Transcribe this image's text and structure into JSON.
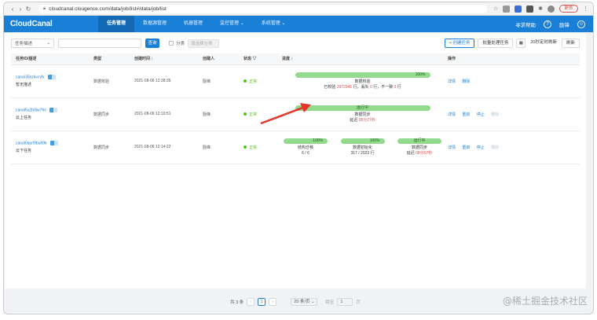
{
  "browser": {
    "url": "cloudcanal.clougence.com/data/job/list#/data/job/list",
    "update_label": "更新"
  },
  "header": {
    "logo": "CloudCanal",
    "nav": [
      "任务管理",
      "数据源管理",
      "机器管理",
      "监控管理 ⌄",
      "系统管理 ⌄"
    ],
    "help": "寻求帮助",
    "user": "励锋"
  },
  "toolbar": {
    "filter_select": "任务描述",
    "query_label": "查询",
    "group_label": "分类",
    "group_placeholder": "请选择分类",
    "create_label": "+ 创建任务",
    "batch_label": "批量处理任务",
    "auto_refresh": "20秒定时刷新",
    "refresh_label": "刷新"
  },
  "table": {
    "headers": [
      "任务ID/描述",
      "类型",
      "创建时间 ↕",
      "创建人",
      "状态 ▽",
      "进度 ↕",
      "操作"
    ],
    "rows": [
      {
        "id": "canal35hzkvcvfx",
        "desc": "暂无描述",
        "type": "数据校验",
        "time": "2021-08-06 12:38:35",
        "user": "励锋",
        "status": "正常",
        "progress": {
          "percent_label": "100%",
          "percent": 1.0,
          "title": "数据校验",
          "checked_prefix": "已校验",
          "checked": "3972941",
          "checked_mid": "行，丢失",
          "lost": "0",
          "lost_mid": "行，不一致",
          "diff": "0",
          "diff_suffix": "行"
        },
        "actions": [
          "详情",
          "删除"
        ]
      },
      {
        "id": "canal5u2b0lw7fnl",
        "desc": "云上任务",
        "type": "数据同步",
        "time": "2021-08-06 12:19:51",
        "user": "励锋",
        "status": "正常",
        "progress": {
          "bar_label": "运行中",
          "title": "数据同步",
          "delay_prefix": "延迟",
          "delay": "08分27秒"
        },
        "actions": [
          "详情",
          "重启",
          "停止",
          "删除"
        ]
      },
      {
        "id": "canal0qurl9bu89k",
        "desc": "云下任务",
        "type": "数据同步",
        "time": "2021-08-06 12:14:22",
        "user": "励锋",
        "status": "正常",
        "progress": {
          "stages": [
            {
              "bar_label": "100%",
              "percent": 1.0,
              "title": "结构迁移",
              "detail": "6 / 6"
            },
            {
              "bar_label": "100%",
              "percent": 1.0,
              "title": "数据初始化",
              "detail": "317 / 2023 行"
            },
            {
              "bar_label": "运行中",
              "title": "数据同步",
              "delay_prefix": "延迟",
              "delay": "08分07秒"
            }
          ]
        },
        "actions": [
          "详情",
          "重启",
          "停止",
          "删除"
        ]
      }
    ]
  },
  "pager": {
    "total": "共 3 条",
    "page": "1",
    "page_size": "20 条/页 ⌄",
    "goto_label": "跳至",
    "goto_value": "1",
    "page_suffix": "页"
  },
  "watermark": "@稀土掘金技术社区",
  "colors": {
    "brand": "#1a7fd6",
    "progress": "#93d98e",
    "ok": "#52c41a",
    "arrow": "#e5352b"
  }
}
